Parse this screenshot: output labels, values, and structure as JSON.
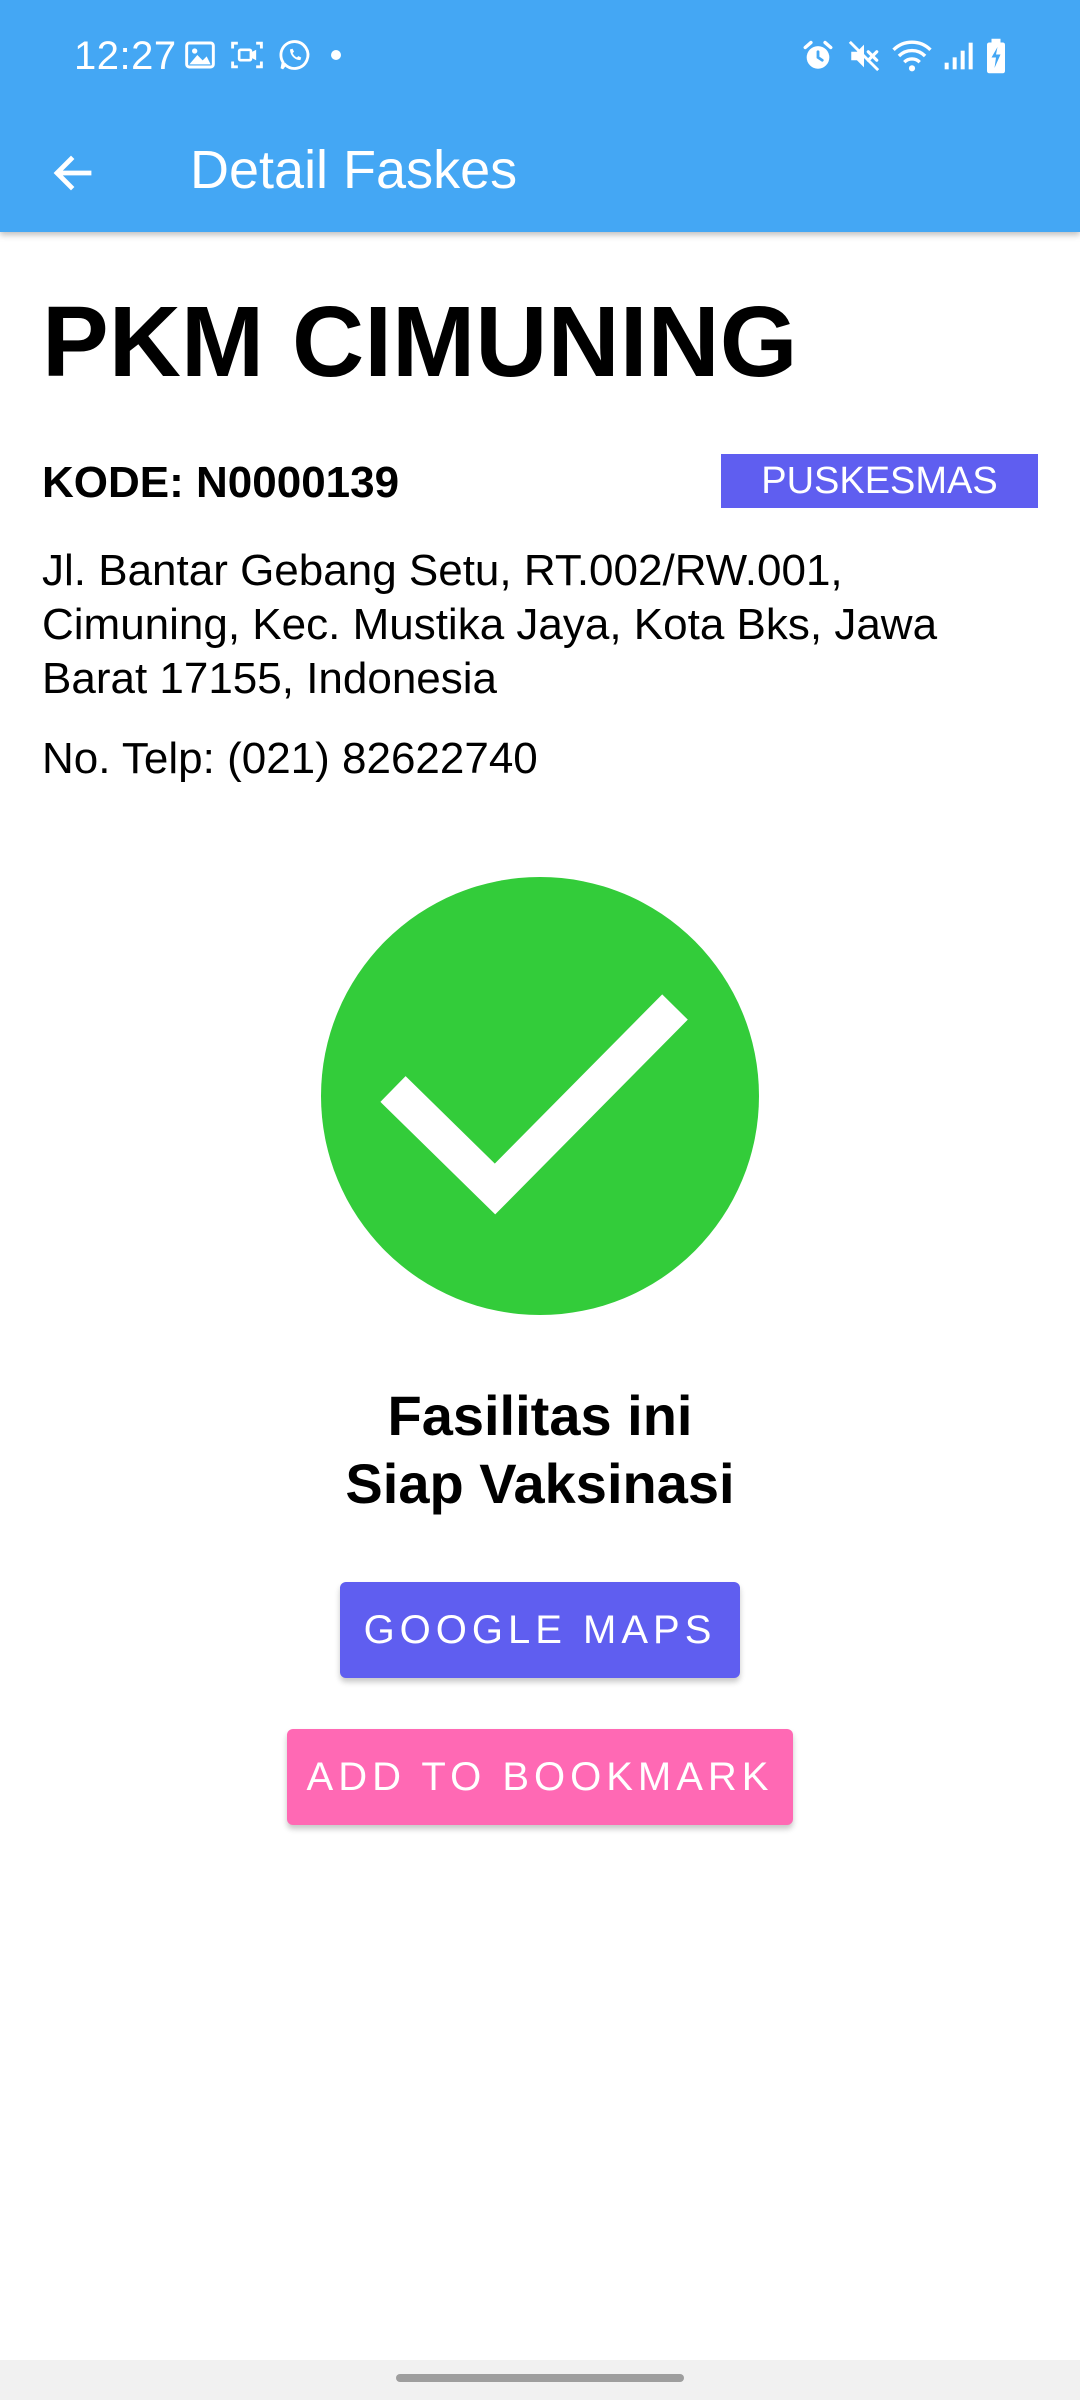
{
  "status_bar": {
    "time": "12:27",
    "left_icons": [
      "image-icon",
      "screen-record-icon",
      "whatsapp-icon",
      "dot-icon"
    ],
    "right_icons": [
      "alarm-icon",
      "mute-icon",
      "wifi-icon",
      "signal-icon",
      "battery-charging-icon"
    ]
  },
  "toolbar": {
    "back_icon": "arrow-back-icon",
    "title": "Detail Faskes"
  },
  "facility": {
    "name": "PKM CIMUNING",
    "code": "KODE: N0000139",
    "type_badge": "PUSKESMAS",
    "address": "Jl. Bantar Gebang Setu, RT.002/RW.001, Cimuning, Kec. Mustika Jaya, Kota Bks, Jawa Barat 17155, Indonesia",
    "phone": "No. Telp: (021) 82622740"
  },
  "status": {
    "icon": "check-circle-icon",
    "line1": "Fasilitas ini",
    "line2": "Siap Vaksinasi"
  },
  "buttons": {
    "maps_label": "GOOGLE MAPS",
    "bookmark_label": "ADD TO BOOKMARK"
  },
  "colors": {
    "header": "#44a7f4",
    "badge": "#5f5ef0",
    "maps_button": "#5f5ef0",
    "bookmark_button": "#ff69b4",
    "check_circle": "#33cc3a"
  }
}
